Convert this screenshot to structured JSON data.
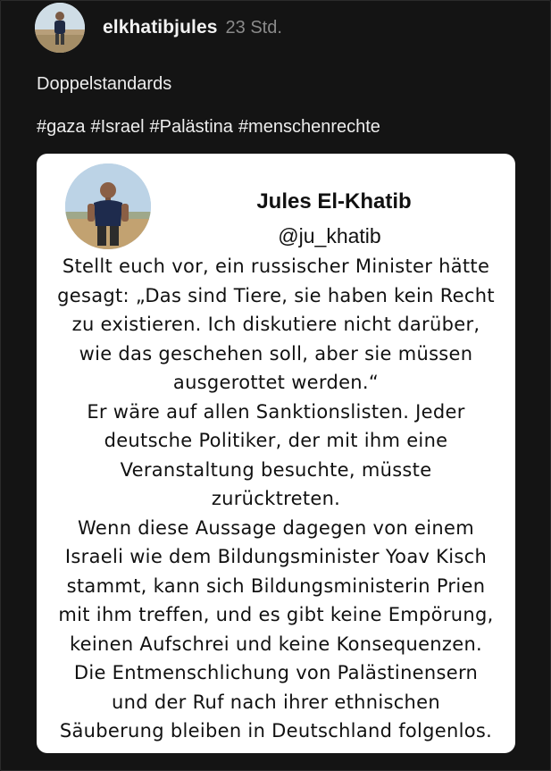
{
  "post": {
    "username": "elkhatibjules",
    "timestamp": "23 Std.",
    "caption": "Doppelstandards",
    "hashtags": [
      "#gaza",
      "#Israel",
      "#Palästina",
      "#menschenrechte"
    ]
  },
  "card": {
    "name": "Jules El-Khatib",
    "handle": "@ju_khatib",
    "lines": [
      "Stellt euch vor, ein russischer Minister hätte",
      "gesagt: „Das sind Tiere, sie haben kein Recht",
      "zu existieren. Ich diskutiere nicht darüber,",
      "wie das geschehen soll, aber sie müssen",
      "ausgerottet werden.“",
      "Er wäre auf allen Sanktionslisten. Jeder",
      "deutsche Politiker, der mit ihm eine",
      "Veranstaltung besuchte, müsste",
      "zurücktreten.",
      "Wenn diese Aussage dagegen von einem",
      "Israeli wie dem Bildungsminister Yoav Kisch",
      "stammt, kann sich Bildungsministerin Prien",
      "mit ihm treffen, und es gibt keine Empörung,",
      "keinen Aufschrei und keine Konsequenzen.",
      "Die Entmenschlichung von Palästinensern",
      "und der Ruf nach ihrer ethnischen",
      "Säuberung bleiben in Deutschland folgenlos."
    ]
  },
  "colors": {
    "background": "#141414",
    "text_primary": "#f2f2f2",
    "text_secondary": "#8a8a8a",
    "card_background": "#ffffff"
  }
}
